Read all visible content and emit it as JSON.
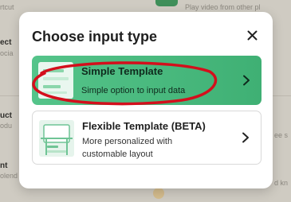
{
  "background": {
    "left_texts": [
      "rtcut",
      "ect",
      "ocia",
      "uct",
      "odu",
      "nt",
      "olend"
    ],
    "top_right_text": "Play video from other pl",
    "right_text_1": "ee s",
    "right_text_2": "d kn"
  },
  "modal": {
    "title": "Choose input type",
    "close_icon": "close-icon",
    "options": [
      {
        "title": "Simple Template",
        "description": "Simple option to input data",
        "selected": true,
        "accent_color": "#4dbb80"
      },
      {
        "title": "Flexible Template (BETA)",
        "description": "More personalized with customable layout",
        "selected": false
      }
    ]
  },
  "annotation": {
    "shape": "ellipse",
    "color": "#d40f1c"
  }
}
